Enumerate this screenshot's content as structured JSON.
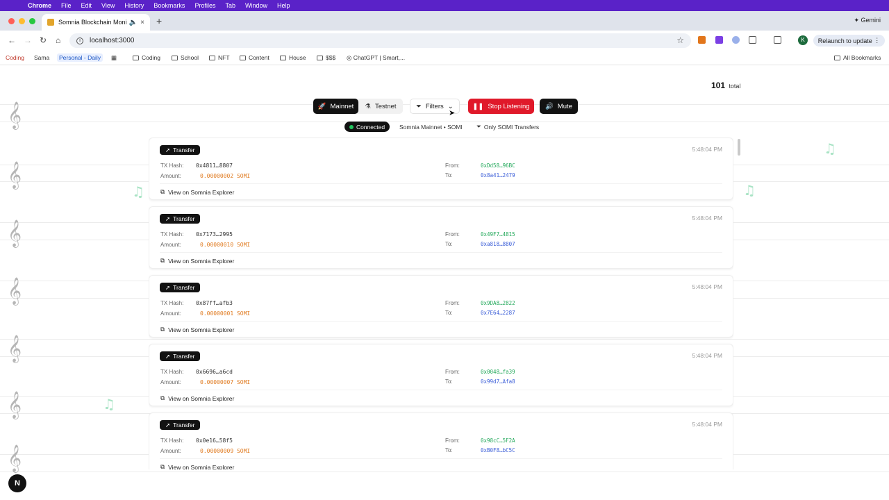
{
  "menubar": {
    "app": "Chrome",
    "items": [
      "File",
      "Edit",
      "View",
      "History",
      "Bookmarks",
      "Profiles",
      "Tab",
      "Window",
      "Help"
    ]
  },
  "browser": {
    "tab_title": "Somnia Blockchain Monit",
    "url": "localhost:3000",
    "gemini_label": "Gemini",
    "relaunch_label": "Relaunch to update",
    "avatar_initial": "K"
  },
  "bookmarks": {
    "items": [
      "Coding",
      "Sama",
      "Personal - Daily",
      "Coding",
      "School",
      "NFT",
      "Content",
      "House",
      "$$$",
      "ChatGPT | Smart,..."
    ],
    "all_bookmarks": "All Bookmarks"
  },
  "header": {
    "total_count": "101",
    "total_label": "total"
  },
  "controls": {
    "mainnet": "Mainnet",
    "testnet": "Testnet",
    "filters": "Filters",
    "stop": "Stop Listening",
    "mute": "Mute"
  },
  "status": {
    "connected": "Connected",
    "network": "Somnia Mainnet • SOMI",
    "filter": "Only SOMI Transfers"
  },
  "labels": {
    "tx_hash": "TX Hash:",
    "amount": "Amount:",
    "from": "From:",
    "to": "To:",
    "explorer": "View on Somnia Explorer"
  },
  "transactions": [
    {
      "type": "Transfer",
      "time": "5:48:04 PM",
      "hash": "0x4811…8807",
      "amount": "0.00000002 SOMI",
      "from": "0xDd58…96BC",
      "to": "0x8a41…2479"
    },
    {
      "type": "Transfer",
      "time": "5:48:04 PM",
      "hash": "0x7173…2995",
      "amount": "0.00000010 SOMI",
      "from": "0x49F7…4815",
      "to": "0xa818…8807"
    },
    {
      "type": "Transfer",
      "time": "5:48:04 PM",
      "hash": "0x87ff…afb3",
      "amount": "0.00000001 SOMI",
      "from": "0x9DA8…2822",
      "to": "0x7E64…2287"
    },
    {
      "type": "Transfer",
      "time": "5:48:04 PM",
      "hash": "0x6696…a6cd",
      "amount": "0.00000007 SOMI",
      "from": "0x0048…fa39",
      "to": "0x99d7…Afa8"
    },
    {
      "type": "Transfer",
      "time": "5:48:04 PM",
      "hash": "0x0e16…58f5",
      "amount": "0.00000009 SOMI",
      "from": "0x98cC…5F2A",
      "to": "0xB0F8…bC5C"
    }
  ],
  "footer": {
    "next_badge": "N"
  },
  "colors": {
    "menubar": "#5a22c8",
    "stop_button": "#e0192a",
    "amount": "#e07a1f",
    "from_address": "#22a85a",
    "to_address": "#3b5ed8",
    "connected_dot": "#22c55e"
  }
}
